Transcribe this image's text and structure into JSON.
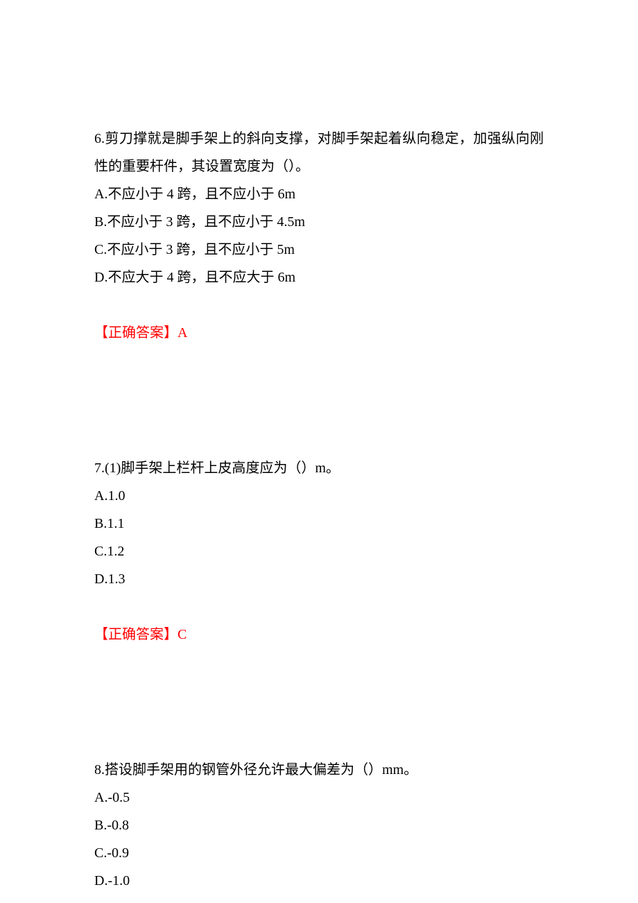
{
  "q6": {
    "stem": "6.剪刀撑就是脚手架上的斜向支撑，对脚手架起着纵向稳定，加强纵向刚性的重要杆件，其设置宽度为（）。",
    "optA": "A.不应小于 4 跨，且不应小于 6m",
    "optB": "B.不应小于 3 跨，且不应小于 4.5m",
    "optC": "C.不应小于 3 跨，且不应小于 5m",
    "optD": "D.不应大于 4 跨，且不应大于 6m",
    "answer": "【正确答案】A"
  },
  "q7": {
    "stem": "7.(1)脚手架上栏杆上皮高度应为（）m。",
    "optA": "A.1.0",
    "optB": "B.1.1",
    "optC": "C.1.2",
    "optD": "D.1.3",
    "answer": "【正确答案】C"
  },
  "q8": {
    "stem": "8.搭设脚手架用的钢管外径允许最大偏差为（）mm。",
    "optA": "A.-0.5",
    "optB": "B.-0.8",
    "optC": "C.-0.9",
    "optD": "D.-1.0"
  }
}
